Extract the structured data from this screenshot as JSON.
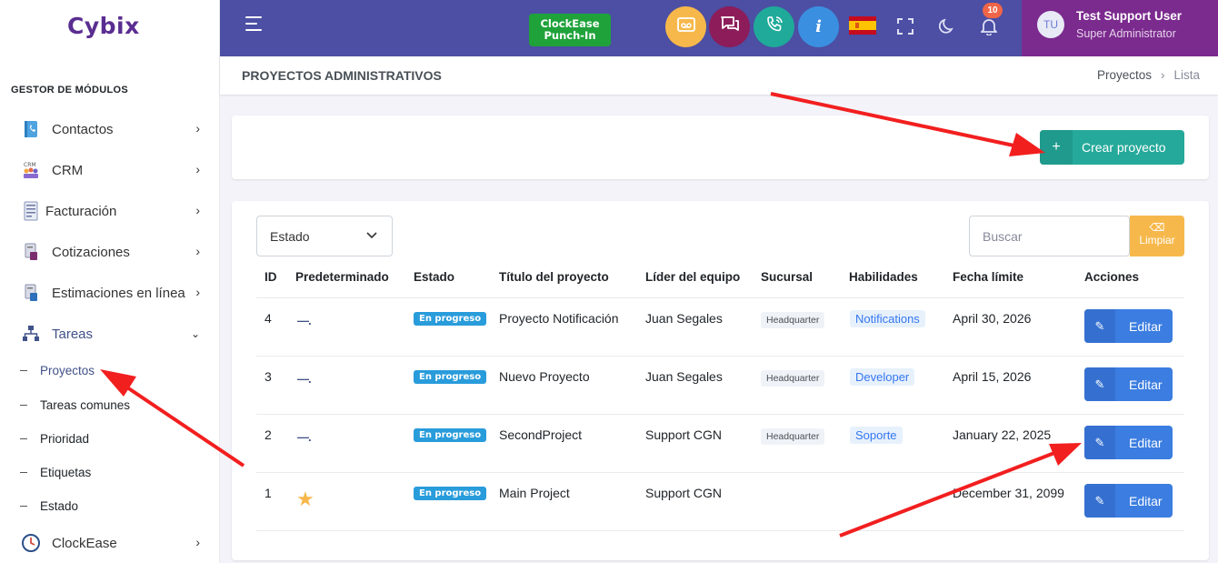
{
  "app": {
    "logo": "Cybix"
  },
  "sidebar": {
    "section_title": "GESTOR DE MÓDULOS",
    "items": [
      {
        "label": "Contactos",
        "icon": "contacts-book-icon"
      },
      {
        "label": "CRM",
        "icon": "crm-icon"
      },
      {
        "label": "Facturación",
        "icon": "invoice-icon"
      },
      {
        "label": "Cotizaciones",
        "icon": "quote-document-icon"
      },
      {
        "label": "Estimaciones en línea",
        "icon": "estimate-document-icon"
      },
      {
        "label": "Tareas",
        "icon": "tasks-hierarchy-icon"
      },
      {
        "label": "ClockEase",
        "icon": "clock-icon"
      }
    ],
    "subitems": [
      {
        "label": "Proyectos"
      },
      {
        "label": "Tareas comunes"
      },
      {
        "label": "Prioridad"
      },
      {
        "label": "Etiquetas"
      },
      {
        "label": "Estado"
      }
    ]
  },
  "topbar": {
    "punch_line1": "ClockEase",
    "punch_line2": "Punch-In",
    "notification_count": "10",
    "user_initials": "TU",
    "user_name": "Test Support User",
    "user_role": "Super Administrator",
    "colors": {
      "bar": "#4c4fa3",
      "user_box": "#7b2a8e",
      "punch": "#1fa23a"
    }
  },
  "page": {
    "title": "PROYECTOS ADMINISTRATIVOS",
    "breadcrumb": [
      "Proyectos",
      "Lista"
    ]
  },
  "toolbar": {
    "create_label": "Crear proyecto",
    "create_icon": "plus-icon"
  },
  "filters": {
    "status_value": "Estado",
    "search_placeholder": "Buscar",
    "clear_label": "Limpiar"
  },
  "table": {
    "headers": [
      "ID",
      "Predeterminado",
      "Estado",
      "Título del proyecto",
      "Líder del equipo",
      "Sucursal",
      "Habilidades",
      "Fecha límite",
      "Acciones"
    ],
    "rows": [
      {
        "id": "4",
        "default": "—.",
        "status": "En progreso",
        "title": "Proyecto Notificación",
        "leader": "Juan Segales",
        "branch": "Headquarter",
        "skill": "Notifications",
        "due": "April 30, 2026",
        "action": "Editar"
      },
      {
        "id": "3",
        "default": "—.",
        "status": "En progreso",
        "title": "Nuevo Proyecto",
        "leader": "Juan Segales",
        "branch": "Headquarter",
        "skill": "Developer",
        "due": "April 15, 2026",
        "action": "Editar"
      },
      {
        "id": "2",
        "default": "—.",
        "status": "En progreso",
        "title": "SecondProject",
        "leader": "Support CGN",
        "branch": "Headquarter",
        "skill": "Soporte",
        "due": "January 22, 2025",
        "action": "Editar"
      },
      {
        "id": "1",
        "default": "★",
        "status": "En progreso",
        "title": "Main Project",
        "leader": "Support CGN",
        "branch": "",
        "skill": "",
        "due": "December 31, 2099",
        "action": "Editar"
      }
    ]
  }
}
